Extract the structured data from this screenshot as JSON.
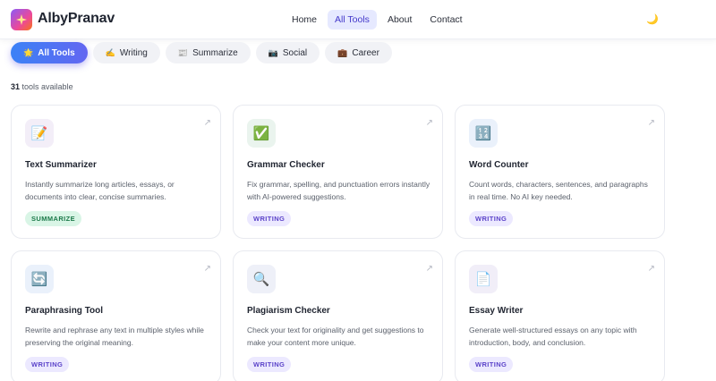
{
  "header": {
    "brand": "AlbyPranav",
    "logo_icon": "sparkle-logo-icon",
    "nav": [
      {
        "label": "Home",
        "active": false
      },
      {
        "label": "All Tools",
        "active": true
      },
      {
        "label": "About",
        "active": false
      },
      {
        "label": "Contact",
        "active": false
      }
    ],
    "theme_icon": "🌙"
  },
  "filters": [
    {
      "icon": "🌟",
      "label": "All Tools",
      "active": true
    },
    {
      "icon": "✍️",
      "label": "Writing",
      "active": false
    },
    {
      "icon": "📰",
      "label": "Summarize",
      "active": false
    },
    {
      "icon": "📷",
      "label": "Social",
      "active": false
    },
    {
      "icon": "💼",
      "label": "Career",
      "active": false
    }
  ],
  "tools_count": {
    "number": "31",
    "text": "tools available"
  },
  "tools": [
    {
      "icon": "📝",
      "title": "Text Summarizer",
      "description": "Instantly summarize long articles, essays, or documents into clear, concise summaries.",
      "tag": "SUMMARIZE",
      "tag_type": "summarize"
    },
    {
      "icon": "✅",
      "title": "Grammar Checker",
      "description": "Fix grammar, spelling, and punctuation errors instantly with AI-powered suggestions.",
      "tag": "WRITING",
      "tag_type": "writing"
    },
    {
      "icon": "🔢",
      "title": "Word Counter",
      "description": "Count words, characters, sentences, and paragraphs in real time. No AI key needed.",
      "tag": "WRITING",
      "tag_type": "writing"
    },
    {
      "icon": "🔄",
      "title": "Paraphrasing Tool",
      "description": "Rewrite and rephrase any text in multiple styles while preserving the original meaning.",
      "tag": "WRITING",
      "tag_type": "writing"
    },
    {
      "icon": "🔍",
      "title": "Plagiarism Checker",
      "description": "Check your text for originality and get suggestions to make your content more unique.",
      "tag": "WRITING",
      "tag_type": "writing"
    },
    {
      "icon": "📄",
      "title": "Essay Writer",
      "description": "Generate well-structured essays on any topic with introduction, body, and conclusion.",
      "tag": "WRITING",
      "tag_type": "writing"
    }
  ],
  "open_icon": "↗"
}
